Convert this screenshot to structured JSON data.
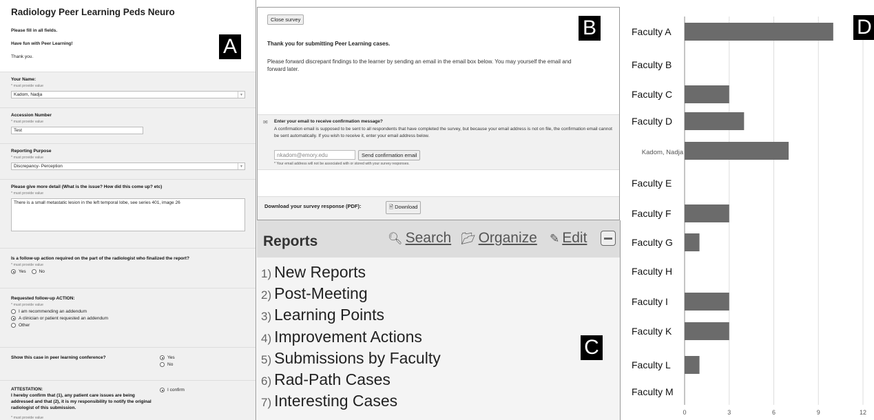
{
  "panel_a": {
    "label": "A",
    "title": "Radiology Peer Learning Peds Neuro",
    "intro": [
      "Please fill in all fields.",
      "Have fun with Peer Learning!",
      "Thank you."
    ],
    "must_text": "* must provide value",
    "your_name": {
      "label": "Your Name:",
      "value": "Kadom, Nadja"
    },
    "accession": {
      "label": "Accession Number",
      "value": "Test"
    },
    "purpose": {
      "label": "Reporting Purpose",
      "value": "Discrepancy- Perception"
    },
    "detail": {
      "label": "Please give more detail (What is the issue? How did this come up? etc)",
      "value": "There is a small metastatic lesion in the left temporal lobe, see series 401, image 26"
    },
    "followup": {
      "label": "Is a follow-up action required on the part of the radiologist who finalized the report?",
      "options": [
        "Yes",
        "No"
      ],
      "selected": "Yes"
    },
    "action": {
      "label": "Requested follow-up ACTION:",
      "options": [
        "I am recommending an addendum",
        "A clinician or patient requested an addendum",
        "Other"
      ],
      "selected": "A clinician or patient requested an addendum"
    },
    "conference": {
      "label": "Show this case in peer learning conference?",
      "options": [
        "Yes",
        "No"
      ],
      "selected": "Yes"
    },
    "attestation": {
      "label_title": "ATTESTATION:",
      "label_body": "I hereby confirm that (1), any patient care issues are being addressed and that (2), it is my responsibility to notify the original radiologist of this submission.",
      "option": "I confirm"
    }
  },
  "panel_b": {
    "label": "B",
    "close_button": "Close survey",
    "thanks": "Thank you for submitting Peer Learning cases.",
    "forward_text": "Please forward discrepant findings to the learner by sending an email in the email box below. You may yourself the email and forward later.",
    "email_heading": "Enter your email to receive confirmation message?",
    "email_desc": "A confirmation email is supposed to be sent to all respondents that have completed the survey, but because your email address is not on file, the confirmation email cannot be sent automatically. If you wish to receive it, enter your email address below.",
    "email_value": "nkadom@emory.edu",
    "send_button": "Send confirmation email",
    "email_note": "* Your email address will not be associated with or stored with your survey responses.",
    "download_label": "Download your survey response (PDF):",
    "download_button": "Download"
  },
  "panel_c": {
    "label": "C",
    "title": "Reports",
    "links": {
      "search": "Search",
      "organize": "Organize",
      "edit": "Edit"
    },
    "items": [
      {
        "num": "1)",
        "text": "New Reports"
      },
      {
        "num": "2)",
        "text": "Post-Meeting"
      },
      {
        "num": "3)",
        "text": "Learning Points"
      },
      {
        "num": "4)",
        "text": "Improvement Actions"
      },
      {
        "num": "5)",
        "text": "Submissions by Faculty"
      },
      {
        "num": "6)",
        "text": "Rad-Path Cases"
      },
      {
        "num": "7)",
        "text": "Interesting Cases"
      }
    ]
  },
  "panel_d": {
    "label": "D"
  },
  "chart_data": {
    "type": "bar",
    "orientation": "horizontal",
    "categories": [
      "Faculty A",
      "Faculty B",
      "Faculty C",
      "Faculty D",
      "Kadom, Nadja",
      "Faculty E",
      "Faculty F",
      "Faculty G",
      "Faculty H",
      "Faculty I",
      "Faculty K",
      "Faculty L",
      "Faculty M"
    ],
    "values": [
      10,
      0,
      3,
      4,
      7,
      0,
      3,
      1,
      0,
      3,
      3,
      1,
      0
    ],
    "xlim": [
      0,
      12
    ],
    "xticks": [
      0,
      3,
      6,
      9,
      12
    ],
    "grid": true,
    "bar_color": "#6b6b6b"
  }
}
